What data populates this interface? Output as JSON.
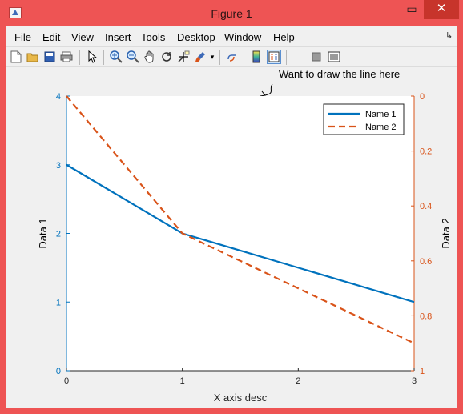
{
  "window": {
    "title": "Figure 1",
    "minimize_glyph": "—",
    "maximize_glyph": "▭",
    "close_glyph": "✕"
  },
  "menu": {
    "items": [
      {
        "label": "File",
        "u": "F",
        "rest": "ile"
      },
      {
        "label": "Edit",
        "u": "E",
        "rest": "dit"
      },
      {
        "label": "View",
        "u": "V",
        "rest": "iew"
      },
      {
        "label": "Insert",
        "u": "I",
        "rest": "nsert"
      },
      {
        "label": "Tools",
        "u": "T",
        "rest": "ools"
      },
      {
        "label": "Desktop",
        "u": "D",
        "rest": "esktop"
      },
      {
        "label": "Window",
        "u": "W",
        "rest": "indow"
      },
      {
        "label": "Help",
        "u": "H",
        "rest": "elp"
      }
    ]
  },
  "toolbar": {
    "icons": [
      "new-figure-icon",
      "open-file-icon",
      "save-icon",
      "print-icon",
      "edit-plot-icon",
      "zoom-in-icon",
      "zoom-out-icon",
      "pan-icon",
      "rotate-3d-icon",
      "data-cursor-icon",
      "brush-icon",
      "link-plot-icon",
      "colorbar-icon",
      "legend-icon",
      "hide-plot-tools-icon",
      "show-plot-tools-icon"
    ]
  },
  "annotation": {
    "text": "Want to draw the line here"
  },
  "chart_data": {
    "type": "line",
    "xlabel": "X axis desc",
    "ylabel_left": "Data 1",
    "ylabel_right": "Data 2",
    "x": [
      0,
      1,
      2,
      3
    ],
    "xlim": [
      0,
      3
    ],
    "xticks": [
      "0",
      "1",
      "2",
      "3"
    ],
    "ylim_left": [
      0,
      4
    ],
    "yticks_left": [
      "0",
      "1",
      "2",
      "3",
      "4"
    ],
    "ylim_right": [
      0,
      1
    ],
    "right_axis_reversed": true,
    "yticks_right": [
      "0",
      "0.2",
      "0.4",
      "0.6",
      "0.8",
      "1"
    ],
    "legend_position": "top-right",
    "series": [
      {
        "name": "Name 1",
        "axis": "left",
        "x": [
          0,
          1,
          2,
          3
        ],
        "values": [
          3,
          2,
          1.5,
          1
        ],
        "color": "#0072bd",
        "style": "solid"
      },
      {
        "name": "Name 2",
        "axis": "right",
        "x": [
          0,
          1,
          3
        ],
        "values": [
          0,
          0.5,
          0.9
        ],
        "color": "#d95319",
        "style": "dashed"
      }
    ],
    "left_axis_color": "#0072bd",
    "right_axis_color": "#d95319",
    "grid": false
  }
}
